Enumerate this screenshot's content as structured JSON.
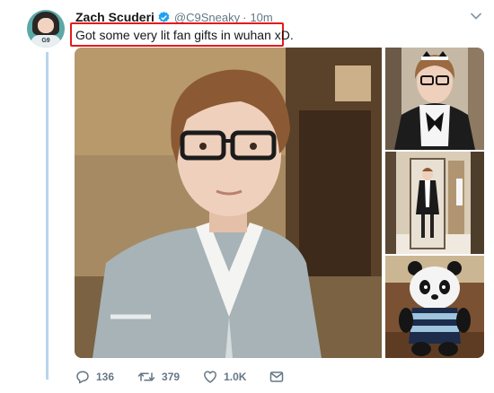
{
  "tweet": {
    "author_name": "Zach Scuderi",
    "handle": "@C9Sneaky",
    "separator": "·",
    "time": "10m",
    "text": "Got some very lit fan gifts in wuhan xD.",
    "verified": true
  },
  "avatar": {
    "badge": "G9"
  },
  "actions": {
    "replies": "136",
    "retweets": "379",
    "likes": "1.0K"
  },
  "icons": [
    "verified-icon",
    "caret-down-icon",
    "reply-icon",
    "retweet-icon",
    "like-icon",
    "direct-message-icon"
  ],
  "colors": {
    "verified_blue": "#1da1f2",
    "highlight_red": "#e21b1b",
    "muted_text": "#657786",
    "thread_line": "#b8d4ee"
  }
}
